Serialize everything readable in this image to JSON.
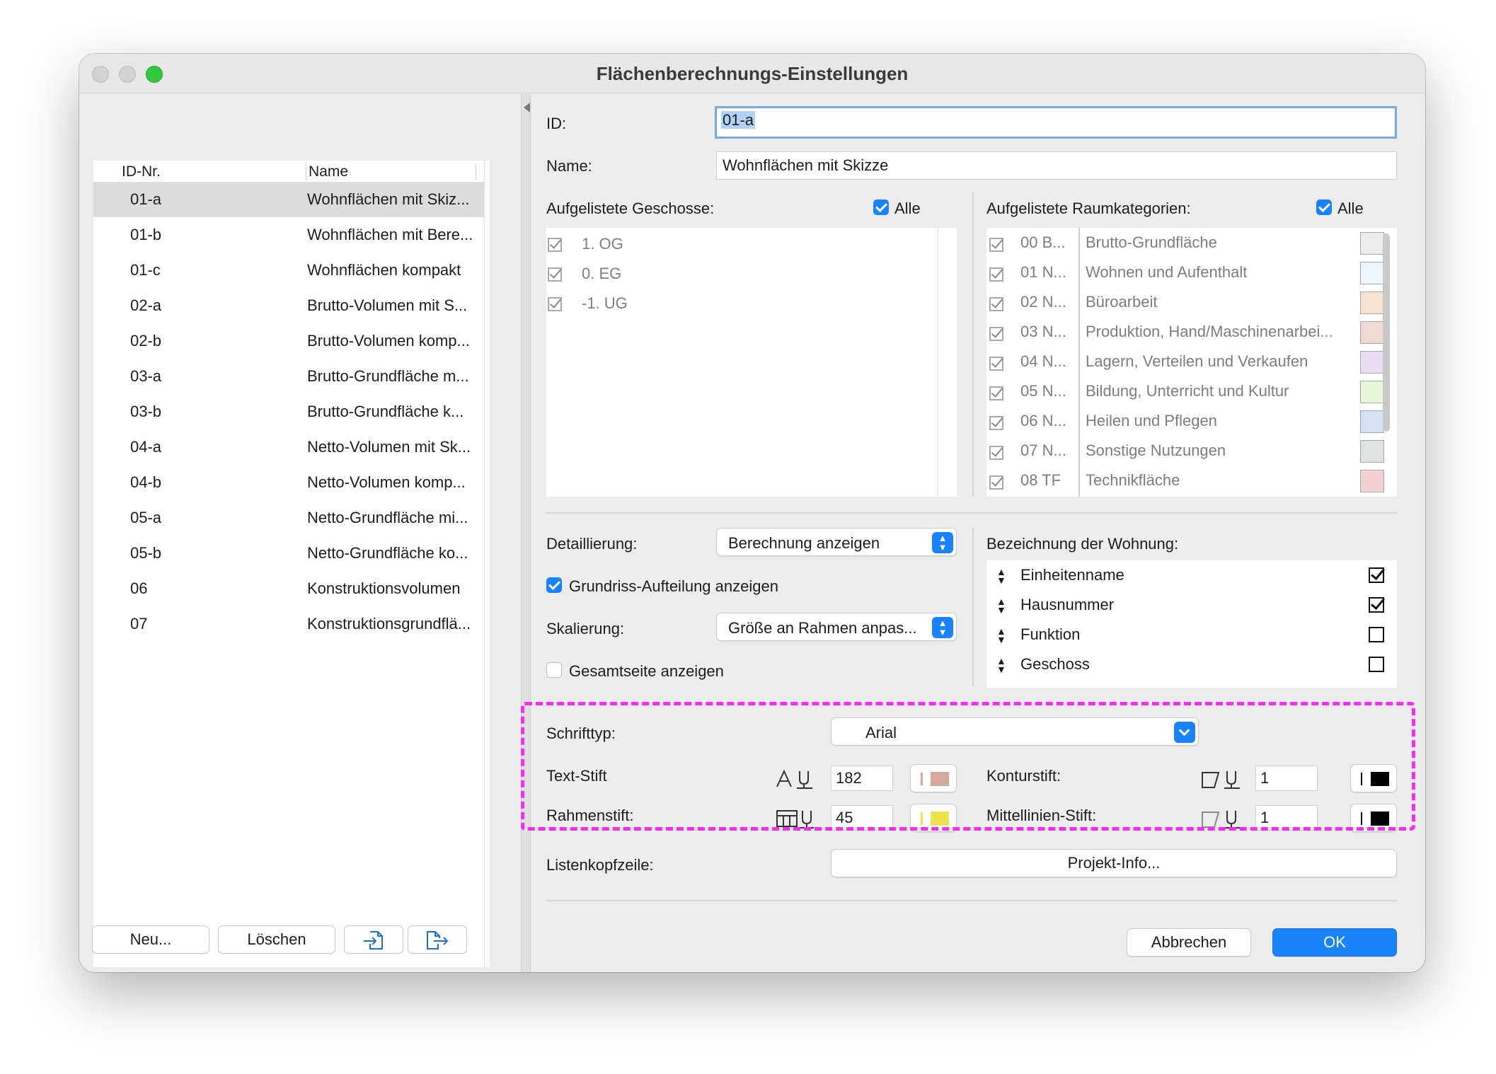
{
  "window": {
    "title": "Flächenberechnungs-Einstellungen"
  },
  "list": {
    "columns": {
      "id": "ID-Nr.",
      "name": "Name"
    },
    "rows": [
      {
        "id": "01-a",
        "name": "Wohnflächen mit Skiz...",
        "selected": true
      },
      {
        "id": "01-b",
        "name": "Wohnflächen mit Bere..."
      },
      {
        "id": "01-c",
        "name": "Wohnflächen kompakt"
      },
      {
        "id": "02-a",
        "name": "Brutto-Volumen mit S..."
      },
      {
        "id": "02-b",
        "name": "Brutto-Volumen komp..."
      },
      {
        "id": "03-a",
        "name": "Brutto-Grundfläche m..."
      },
      {
        "id": "03-b",
        "name": "Brutto-Grundfläche k..."
      },
      {
        "id": "04-a",
        "name": "Netto-Volumen mit Sk..."
      },
      {
        "id": "04-b",
        "name": "Netto-Volumen komp..."
      },
      {
        "id": "05-a",
        "name": "Netto-Grundfläche mi..."
      },
      {
        "id": "05-b",
        "name": "Netto-Grundfläche ko..."
      },
      {
        "id": "06",
        "name": "Konstruktionsvolumen"
      },
      {
        "id": "07",
        "name": "Konstruktionsgrundflä..."
      }
    ],
    "buttons": {
      "new": "Neu...",
      "delete": "Löschen",
      "import_icon": "import-file-icon",
      "export_icon": "export-file-icon"
    }
  },
  "form": {
    "id_label": "ID:",
    "id_value": "01-a",
    "name_label": "Name:",
    "name_value": "Wohnflächen mit Skizze",
    "floors": {
      "label": "Aufgelistete Geschosse:",
      "all_label": "Alle",
      "all_checked": true,
      "items": [
        {
          "label": "1. OG",
          "checked": true
        },
        {
          "label": "0. EG",
          "checked": true
        },
        {
          "label": "-1. UG",
          "checked": true
        }
      ]
    },
    "categories": {
      "label": "Aufgelistete Raumkategorien:",
      "all_label": "Alle",
      "all_checked": true,
      "items": [
        {
          "code": "00 B...",
          "name": "Brutto-Grundfläche",
          "color": "#ececec"
        },
        {
          "code": "01 N...",
          "name": "Wohnen und Aufenthalt",
          "color": "#eef6fd"
        },
        {
          "code": "02 N...",
          "name": "Büroarbeit",
          "color": "#f6e3d2"
        },
        {
          "code": "03 N...",
          "name": "Produktion, Hand/Maschinenarbei...",
          "color": "#f0d8d3"
        },
        {
          "code": "04 N...",
          "name": "Lagern, Verteilen und Verkaufen",
          "color": "#eadcf2"
        },
        {
          "code": "05 N...",
          "name": "Bildung, Unterricht und Kultur",
          "color": "#e6f7da"
        },
        {
          "code": "06 N...",
          "name": "Heilen und Pflegen",
          "color": "#d4e1f2"
        },
        {
          "code": "07 N...",
          "name": "Sonstige Nutzungen",
          "color": "#dfe3df"
        },
        {
          "code": "08 TF",
          "name": "Technikfläche",
          "color": "#f1cfd2"
        }
      ]
    },
    "detail_label": "Detaillierung:",
    "detail_value": "Berechnung anzeigen",
    "plan_split_label": "Grundriss-Aufteilung anzeigen",
    "plan_split_checked": true,
    "scaling_label": "Skalierung:",
    "scaling_value": "Größe an Rahmen anpas...",
    "total_page_label": "Gesamtseite anzeigen",
    "total_page_checked": false,
    "apartment": {
      "label": "Bezeichnung der Wohnung:",
      "items": [
        {
          "label": "Einheitenname",
          "checked": true
        },
        {
          "label": "Hausnummer",
          "checked": true
        },
        {
          "label": "Funktion",
          "checked": false
        },
        {
          "label": "Geschoss",
          "checked": false
        }
      ]
    },
    "font_label": "Schrifttyp:",
    "font_value": "Arial",
    "text_pen": {
      "label": "Text-Stift",
      "value": "182",
      "color": "#d4a89a",
      "bar_color": "#d4a89a"
    },
    "contour_pen": {
      "label": "Konturstift:",
      "value": "1",
      "color": "#000000"
    },
    "frame_pen": {
      "label": "Rahmenstift:",
      "value": "45",
      "color": "#ede34e",
      "bar_color": "#ede34e"
    },
    "centerline_pen": {
      "label": "Mittellinien-Stift:",
      "value": "1",
      "color": "#000000"
    },
    "list_header_label": "Listenkopfzeile:",
    "list_header_button": "Projekt-Info..."
  },
  "footer": {
    "cancel": "Abbrechen",
    "ok": "OK"
  },
  "colors": {
    "accent": "#1a82fb",
    "highlight": "#f22ff0"
  }
}
